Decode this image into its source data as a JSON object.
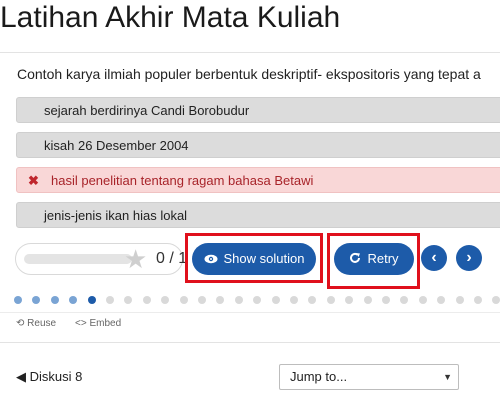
{
  "page": {
    "title": "Latihan Akhir Mata Kuliah"
  },
  "quiz": {
    "question": "Contoh karya ilmiah populer berbentuk deskriptif- ekspositoris yang tepat a",
    "options": [
      {
        "label": "sejarah berdirinya Candi Borobudur",
        "state": "neutral"
      },
      {
        "label": "kisah 26 Desember 2004",
        "state": "neutral"
      },
      {
        "label": "hasil penelitian tentang ragam bahasa Betawi",
        "state": "wrong"
      },
      {
        "label": "jenis-jenis ikan hias lokal",
        "state": "neutral"
      }
    ],
    "wrong_mark": "✖",
    "score": {
      "text": "0 / 1",
      "fraction": 0
    },
    "show_solution_label": "Show solution",
    "retry_label": "Retry",
    "prev_glyph": "‹",
    "next_glyph": "›"
  },
  "progress_dots": {
    "total": 27,
    "done": 4,
    "current_index": 4
  },
  "footer": {
    "reuse_label": "Reuse",
    "embed_label": "Embed"
  },
  "bottom_nav": {
    "prev_label": "Diskusi 8",
    "jump_label": "Jump to..."
  },
  "colors": {
    "accent": "#1d5ba9",
    "highlight": "#e0101c",
    "wrong": "#c0262d"
  }
}
